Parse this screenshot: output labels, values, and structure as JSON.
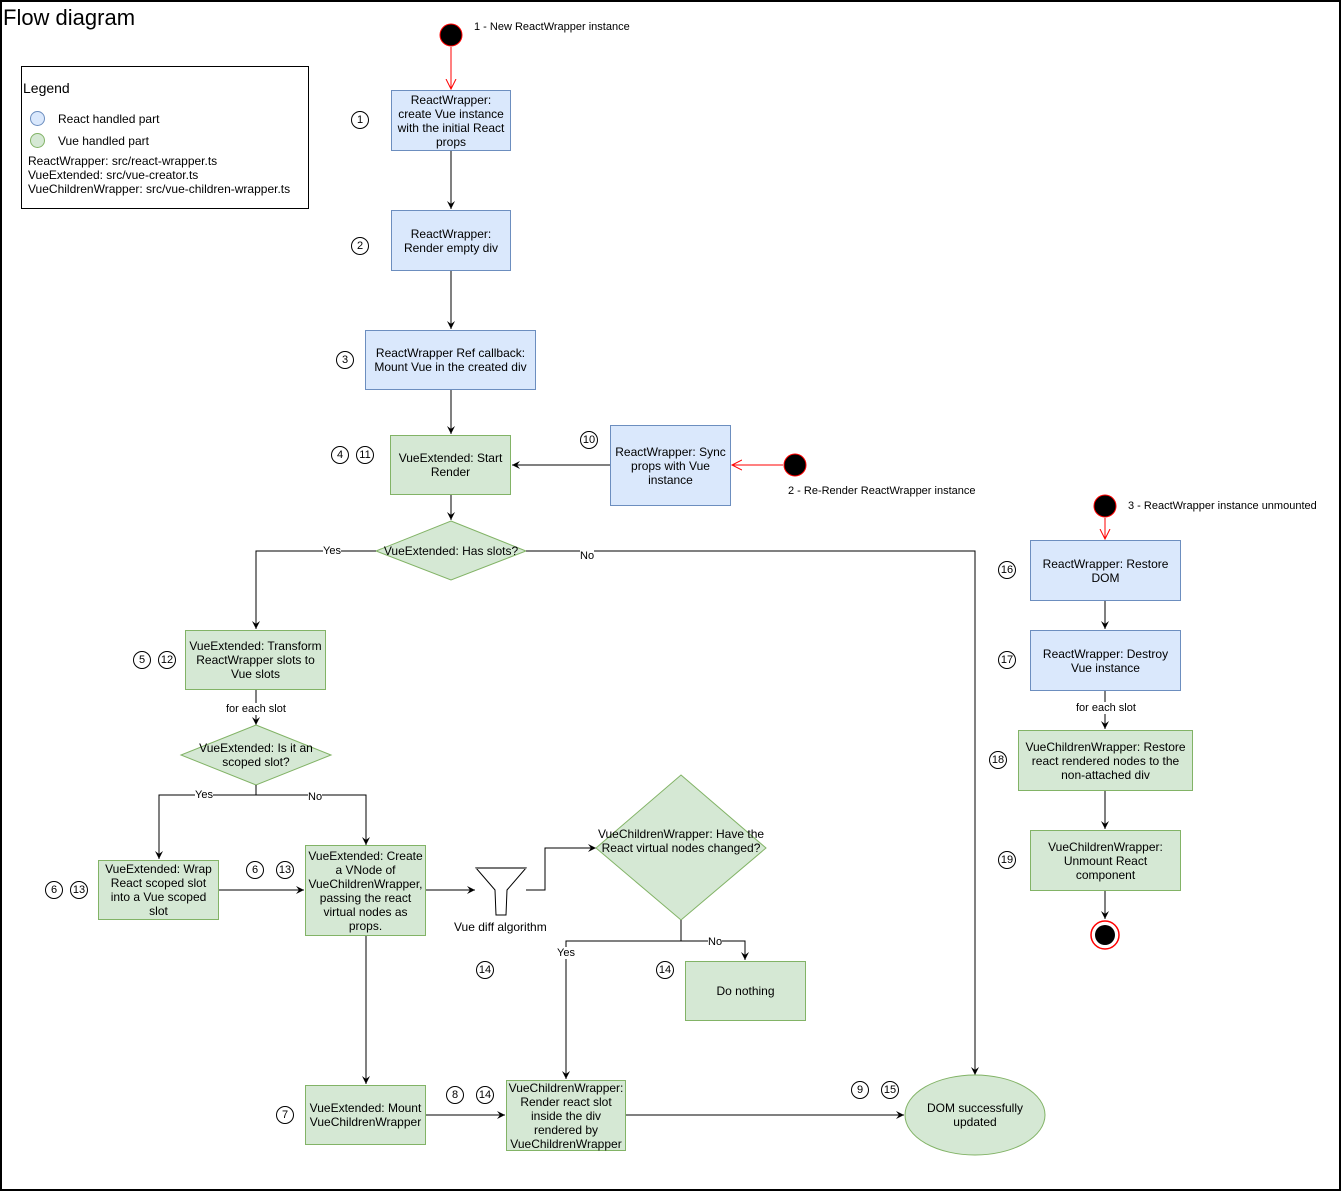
{
  "title": "Flow diagram",
  "legend": {
    "title": "Legend",
    "items": [
      {
        "label": "React handled part",
        "fill": "#dae8fc",
        "stroke": "#6c8ebf"
      },
      {
        "label": "Vue handled part",
        "fill": "#d5e8d4",
        "stroke": "#82b366"
      }
    ],
    "files": [
      "ReactWrapper: src/react-wrapper.ts",
      "VueExtended: src/vue-creator.ts",
      "VueChildrenWrapper: src/vue-children-wrapper.ts"
    ]
  },
  "start_events": {
    "new_instance": "1 - New ReactWrapper instance",
    "re_render": "2 - Re-Render ReactWrapper instance",
    "unmounted": "3 - ReactWrapper instance unmounted"
  },
  "nodes": {
    "create_vue": "ReactWrapper: create Vue instance with the initial React props",
    "render_div": "ReactWrapper: Render empty div",
    "ref_callback": "ReactWrapper Ref callback: Mount Vue in the created div",
    "start_render": "VueExtended: Start Render",
    "sync_props": "ReactWrapper: Sync props with Vue instance",
    "has_slots": "VueExtended:  Has slots?",
    "transform_slots": "VueExtended: Transform ReactWrapper slots to Vue slots",
    "scoped_slot": "VueExtended: Is it an scoped slot?",
    "wrap_scoped": "VueExtended: Wrap React scoped slot into a Vue scoped slot",
    "create_vnode": "VueExtended: Create a VNode of VueChildrenWrapper, passing the react virtual nodes as props.",
    "diff_algorithm": "Vue diff algorithm",
    "nodes_changed": "VueChildrenWrapper: Have the React virtual nodes changed?",
    "do_nothing": "Do nothing",
    "mount_children": "VueExtended: Mount VueChildrenWrapper",
    "render_slot": "VueChildrenWrapper: Render react slot inside the div rendered by VueChildrenWrapper",
    "dom_updated": "DOM successfully updated",
    "restore_dom": "ReactWrapper: Restore DOM",
    "destroy_vue": "ReactWrapper: Destroy Vue instance",
    "restore_nodes": "VueChildrenWrapper: Restore react rendered nodes to the non-attached div",
    "unmount_react": "VueChildrenWrapper: Unmount React component"
  },
  "edge_labels": {
    "yes": "Yes",
    "no": "No",
    "for_each_slot": "for each slot"
  },
  "steps": {
    "s1": "1",
    "s2": "2",
    "s3": "3",
    "s4": "4",
    "s11": "11",
    "s10": "10",
    "s5": "5",
    "s12": "12",
    "s6a": "6",
    "s13a": "13",
    "s6b": "6",
    "s13b": "13",
    "s7": "7",
    "s8": "8",
    "s14a": "14",
    "s14b": "14",
    "s14c": "14",
    "s9": "9",
    "s15": "15",
    "s16": "16",
    "s17": "17",
    "s18": "18",
    "s19": "19"
  }
}
